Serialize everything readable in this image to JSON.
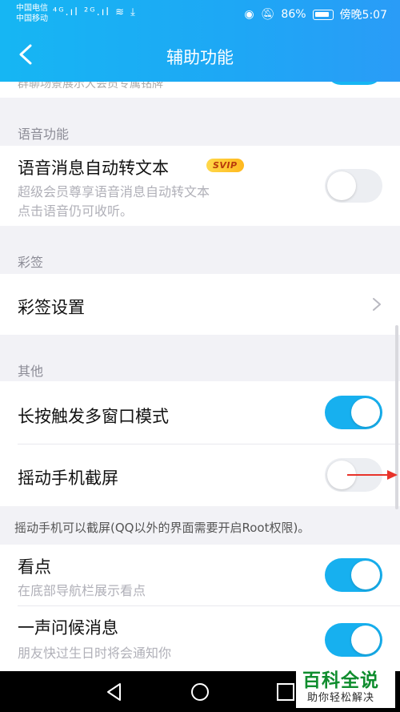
{
  "status_bar": {
    "carrier1": "中国电信",
    "carrier2": "中国移动",
    "signal_left": "⁴ᴳ.ıl ²ᴳ.ıl ≋ ⤓",
    "battery": "86%",
    "time": "傍晚5:07"
  },
  "header": {
    "title": "辅助功能"
  },
  "cut_item": {
    "text": "群聊场景展示大会员专属铭牌"
  },
  "sections": {
    "voice": {
      "header": "语音功能",
      "title": "语音消息自动转文本",
      "badge": "SVIP",
      "sub1": "超级会员尊享语音消息自动转文本",
      "sub2": "点击语音仍可收听。",
      "toggle": "off"
    },
    "caiqian": {
      "header": "彩签",
      "title": "彩签设置"
    },
    "other": {
      "header": "其他",
      "long_press_title": "长按触发多窗口模式",
      "long_press_toggle": "on",
      "shake_title": "摇动手机截屏",
      "shake_toggle": "off",
      "shake_note": "摇动手机可以截屏(QQ以外的界面需要开启Root权限)。"
    },
    "kandian": {
      "title": "看点",
      "sub": "在底部导航栏展示看点",
      "toggle": "on"
    },
    "greeting": {
      "title": "一声问候消息",
      "sub": "朋友快过生日时将会通知你",
      "toggle": "on"
    }
  },
  "watermark": {
    "title": "百科全说",
    "sub": "助你轻松解决"
  },
  "colors": {
    "accent": "#17b0ef",
    "annotation_arrow": "#e8332a"
  }
}
